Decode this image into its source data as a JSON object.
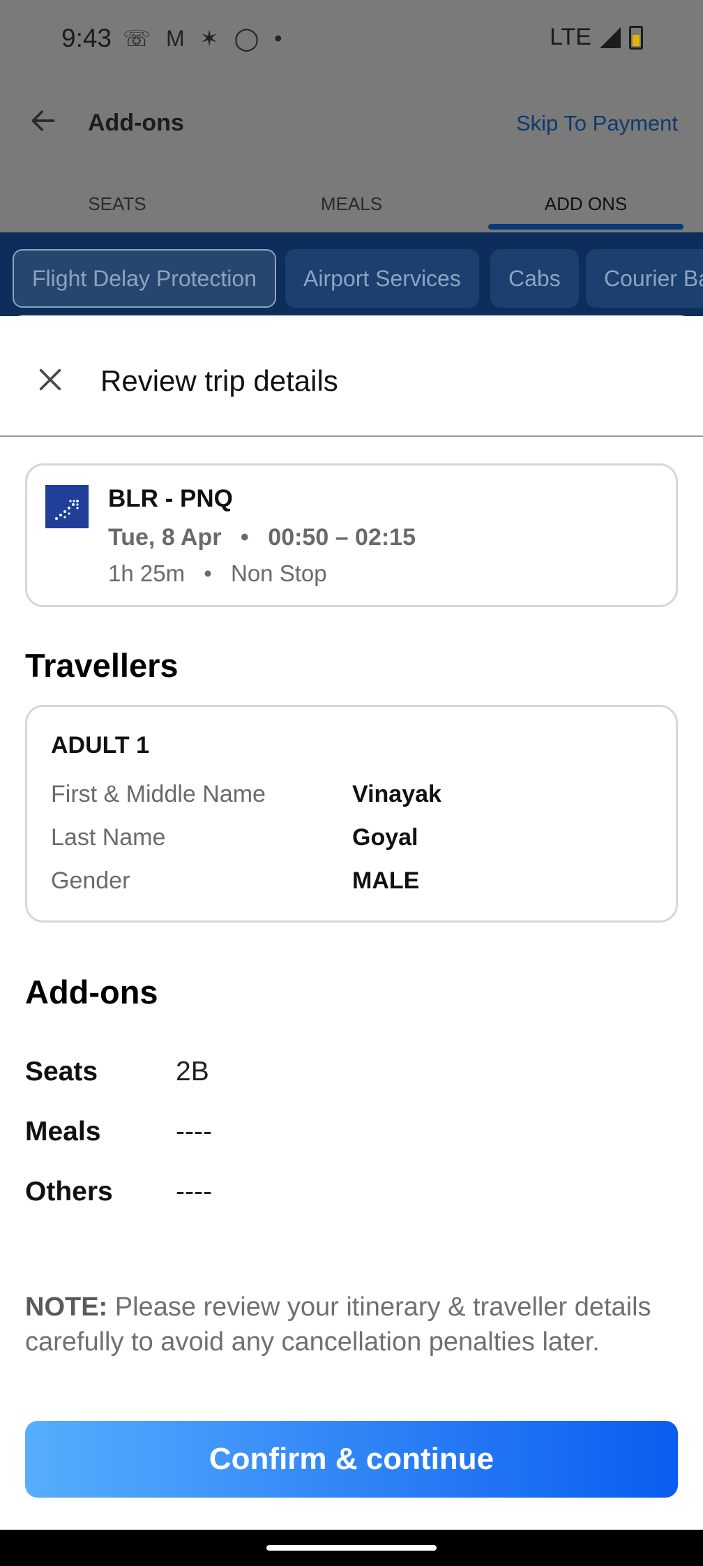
{
  "status_bar": {
    "time": "9:43",
    "notification_icons": [
      "whatsapp-icon",
      "gmail-icon",
      "pinwheel-icon",
      "instagram-icon",
      "dot-icon"
    ],
    "network": "LTE"
  },
  "header": {
    "title": "Add-ons",
    "skip_label": "Skip To Payment"
  },
  "tabs": [
    {
      "label": "SEATS",
      "active": false
    },
    {
      "label": "MEALS",
      "active": false
    },
    {
      "label": "ADD ONS",
      "active": true
    }
  ],
  "chips": [
    {
      "label": "Flight Delay Protection",
      "selected": true
    },
    {
      "label": "Airport Services",
      "selected": false
    },
    {
      "label": "Cabs",
      "selected": false
    },
    {
      "label": "Courier Ba",
      "selected": false
    }
  ],
  "sheet": {
    "title": "Review trip details",
    "flight": {
      "route": "BLR - PNQ",
      "date": "Tue, 8 Apr",
      "times": "00:50 – 02:15",
      "duration": "1h 25m",
      "stops": "Non Stop",
      "separator": "•"
    },
    "travellers_title": "Travellers",
    "traveller": {
      "type": "ADULT 1",
      "rows": [
        {
          "label": "First & Middle Name",
          "value": "Vinayak"
        },
        {
          "label": "Last Name",
          "value": "Goyal"
        },
        {
          "label": "Gender",
          "value": "MALE"
        }
      ]
    },
    "addons_title": "Add-ons",
    "addons": [
      {
        "label": "Seats",
        "value": "2B"
      },
      {
        "label": "Meals",
        "value": "----"
      },
      {
        "label": "Others",
        "value": "----"
      }
    ],
    "note_label": "NOTE:",
    "note_text": " Please review your itinerary & traveller details carefully to avoid any cancellation penalties later.",
    "confirm_label": "Confirm & continue"
  },
  "colors": {
    "accent_start": "#57aefd",
    "accent_end": "#0a5df0",
    "chip_bg": "#1b3f6e",
    "chips_row_bg": "#0d2d5a"
  }
}
